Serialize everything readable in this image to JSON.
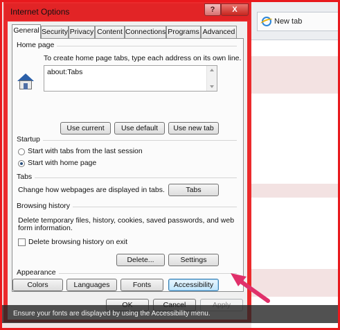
{
  "background": {
    "tab_label": "New tab"
  },
  "window": {
    "title": "Internet Options",
    "help_label": "?",
    "close_label": "X"
  },
  "tabs": [
    {
      "label": "General"
    },
    {
      "label": "Security"
    },
    {
      "label": "Privacy"
    },
    {
      "label": "Content"
    },
    {
      "label": "Connections"
    },
    {
      "label": "Programs"
    },
    {
      "label": "Advanced"
    }
  ],
  "home_page": {
    "group_label": "Home page",
    "description": "To create home page tabs, type each address on its own line.",
    "value": "about:Tabs",
    "use_current": "Use current",
    "use_default": "Use default",
    "use_new_tab": "Use new tab"
  },
  "startup": {
    "group_label": "Startup",
    "option_last_session": "Start with tabs from the last session",
    "option_home_page": "Start with home page",
    "selected": "home_page"
  },
  "tabs_section": {
    "group_label": "Tabs",
    "description": "Change how webpages are displayed in tabs.",
    "button": "Tabs"
  },
  "browsing_history": {
    "group_label": "Browsing history",
    "description_line1": "Delete temporary files, history, cookies, saved passwords, and web",
    "description_line2": "form information.",
    "delete_on_exit": "Delete browsing history on exit",
    "delete_on_exit_checked": false,
    "delete_button": "Delete...",
    "settings_button": "Settings"
  },
  "appearance": {
    "group_label": "Appearance",
    "colors": "Colors",
    "languages": "Languages",
    "fonts": "Fonts",
    "accessibility": "Accessibility"
  },
  "dialog_buttons": {
    "ok": "OK",
    "cancel": "Cancel",
    "apply": "Apply"
  },
  "caption": "Ensure your fonts are displayed by using the Accessibility menu.",
  "colors": {
    "frame": "#e8191d",
    "arrow": "#e0306a",
    "focus": "#3c7fb1"
  }
}
